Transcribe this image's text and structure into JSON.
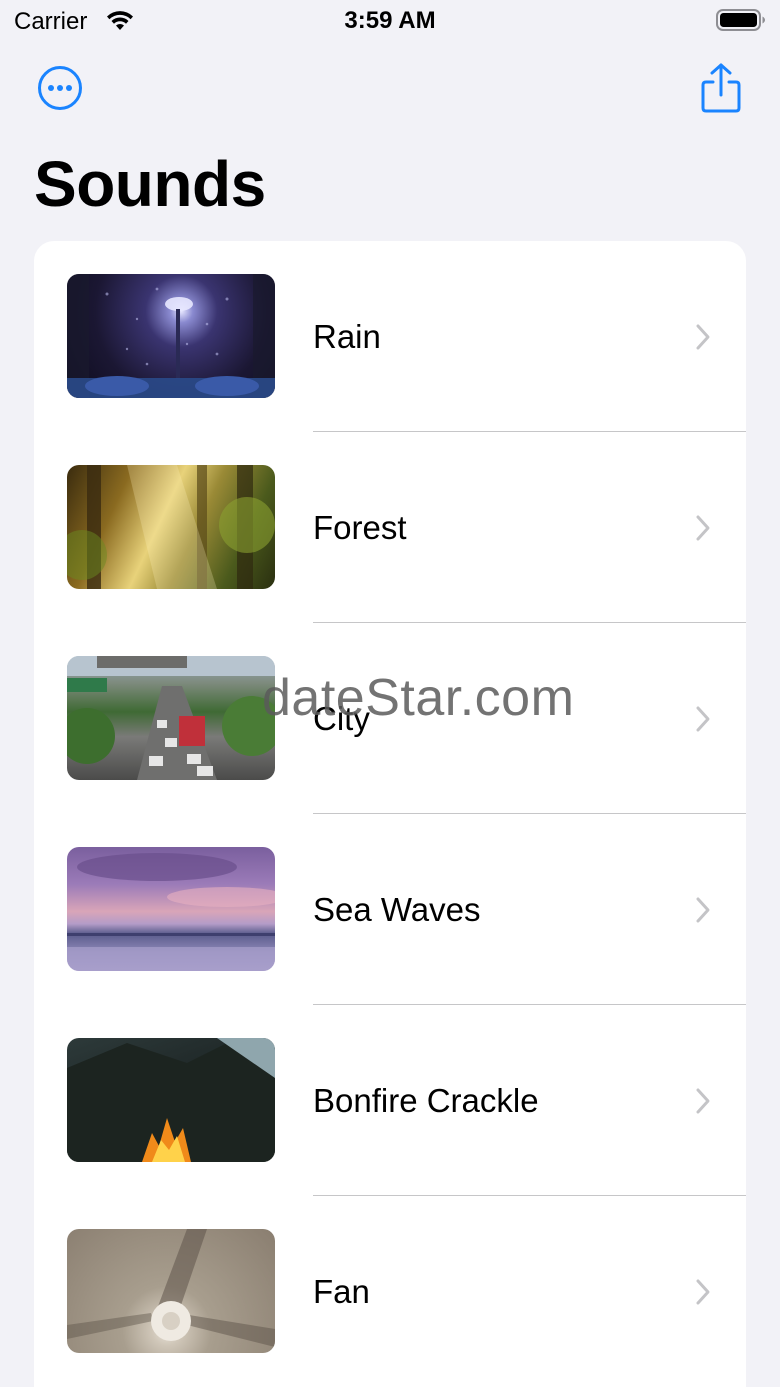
{
  "status_bar": {
    "carrier": "Carrier",
    "time": "3:59 AM"
  },
  "nav": {
    "more_icon": "ellipsis-circle-icon",
    "share_icon": "share-icon",
    "accent_color": "#1a84ff"
  },
  "page": {
    "title": "Sounds"
  },
  "sounds": [
    {
      "label": "Rain",
      "thumbnail": "rain-thumbnail"
    },
    {
      "label": "Forest",
      "thumbnail": "forest-thumbnail"
    },
    {
      "label": "City",
      "thumbnail": "city-thumbnail"
    },
    {
      "label": "Sea Waves",
      "thumbnail": "sea-waves-thumbnail"
    },
    {
      "label": "Bonfire Crackle",
      "thumbnail": "bonfire-thumbnail"
    },
    {
      "label": "Fan",
      "thumbnail": "fan-thumbnail"
    }
  ],
  "watermark": "dateStar.com"
}
